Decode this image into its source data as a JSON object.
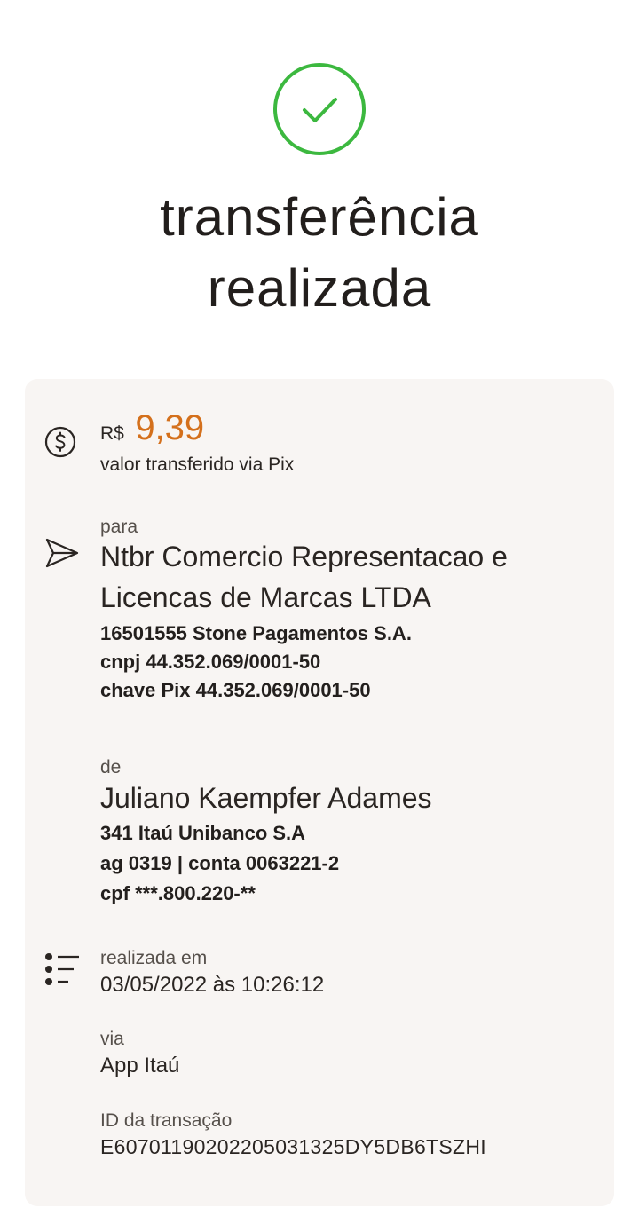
{
  "header": {
    "title_line1": "transferência",
    "title_line2": "realizada",
    "status_color": "#3cb83f",
    "status_icon": "check-circle-icon"
  },
  "amount": {
    "currency": "R$",
    "value": "9,39",
    "caption": "valor transferido via Pix",
    "accent_color": "#d4701c"
  },
  "recipient": {
    "label": "para",
    "name_line1": "Ntbr Comercio Representacao e",
    "name_line2": "Licencas de Marcas LTDA",
    "bank": "16501555 Stone Pagamentos S.A.",
    "cnpj": "cnpj 44.352.069/0001-50",
    "pix_key": "chave Pix 44.352.069/0001-50"
  },
  "sender": {
    "label": "de",
    "name": "Juliano Kaempfer Adames",
    "bank": "341 Itaú Unibanco S.A",
    "account": "ag 0319 | conta 0063221-2",
    "cpf": "cpf ***.800.220-**"
  },
  "details": {
    "date_label": "realizada em",
    "date_value": "03/05/2022 às 10:26:12",
    "via_label": "via",
    "via_value": "App Itaú",
    "id_label": "ID da transação",
    "id_value": "E60701190202205031325DY5DB6TSZHI"
  }
}
